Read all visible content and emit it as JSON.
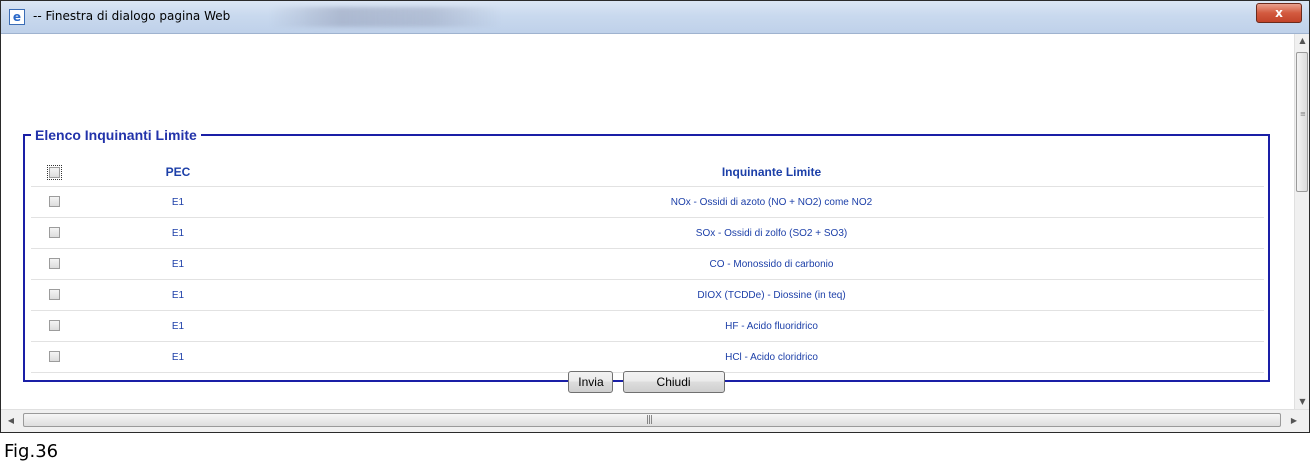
{
  "window": {
    "title": "-- Finestra di dialogo pagina Web",
    "close_label": "x"
  },
  "fieldset": {
    "legend": "Elenco Inquinanti Limite"
  },
  "table": {
    "headers": [
      "PEC",
      "Inquinante Limite"
    ],
    "rows": [
      {
        "pec": "E1",
        "pollutant": "NOx - Ossidi di azoto (NO + NO2) come NO2"
      },
      {
        "pec": "E1",
        "pollutant": "SOx - Ossidi di zolfo (SO2 + SO3)"
      },
      {
        "pec": "E1",
        "pollutant": "CO - Monossido di carbonio"
      },
      {
        "pec": "E1",
        "pollutant": "DIOX (TCDDe) - Diossine (in teq)"
      },
      {
        "pec": "E1",
        "pollutant": "HF - Acido fluoridrico"
      },
      {
        "pec": "E1",
        "pollutant": "HCl - Acido cloridrico"
      }
    ]
  },
  "buttons": {
    "send": "Invia",
    "close": "Chiudi"
  },
  "caption": "Fig.36"
}
